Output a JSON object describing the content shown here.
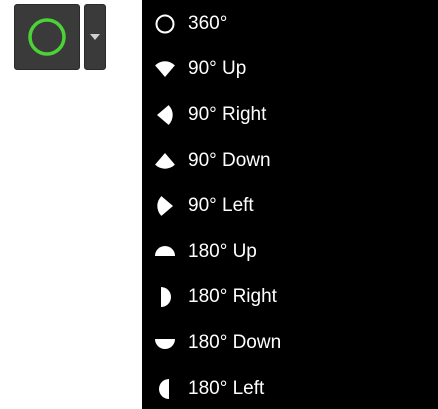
{
  "toolbar": {
    "shape_icon": "circle-outline-icon",
    "accent_color": "#4cd137",
    "dropdown_icon": "chevron-down-icon"
  },
  "menu": {
    "items": [
      {
        "label": "360°",
        "icon": "full-circle-outline-icon"
      },
      {
        "label": "90° Up",
        "icon": "quarter-wedge-up-icon"
      },
      {
        "label": "90° Right",
        "icon": "quarter-wedge-right-icon"
      },
      {
        "label": "90° Down",
        "icon": "quarter-wedge-down-icon"
      },
      {
        "label": "90° Left",
        "icon": "quarter-wedge-left-icon"
      },
      {
        "label": "180° Up",
        "icon": "half-circle-up-icon"
      },
      {
        "label": "180° Right",
        "icon": "half-circle-right-icon"
      },
      {
        "label": "180° Down",
        "icon": "half-circle-down-icon"
      },
      {
        "label": "180° Left",
        "icon": "half-circle-left-icon"
      }
    ]
  }
}
